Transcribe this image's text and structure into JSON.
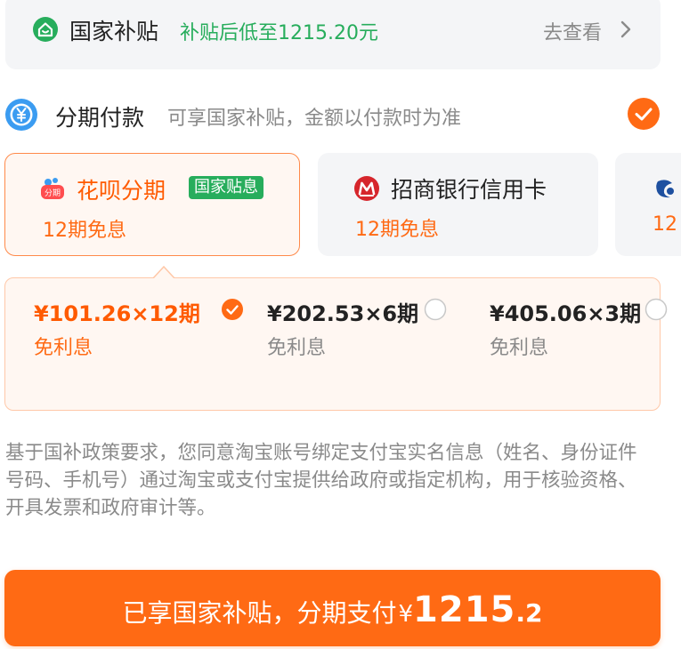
{
  "subsidy_bar": {
    "title": "国家补贴",
    "price_text": "补贴后低至1215.20元",
    "link": "去查看",
    "icon": "house-shield-icon",
    "accent_color": "#27ad5c"
  },
  "installment": {
    "title": "分期付款",
    "subtitle": "可享国家补贴，金额以付款时为准",
    "checked": true,
    "accent_color": "#ff6a14"
  },
  "channels": [
    {
      "name": "花呗分期",
      "badge": "国家贴息",
      "sub": "12期免息",
      "icon": "huabei-icon",
      "icon_text": "分期",
      "selected": true
    },
    {
      "name": "招商银行信用卡",
      "sub": "12期免息",
      "icon": "cmb-icon",
      "selected": false
    },
    {
      "name": "",
      "sub": "12",
      "icon": "bank-icon",
      "selected": false
    }
  ],
  "plans": [
    {
      "price": "¥101.26×12期",
      "sub": "免利息",
      "selected": true
    },
    {
      "price": "¥202.53×6期",
      "sub": "免利息",
      "selected": false
    },
    {
      "price": "¥405.06×3期",
      "sub": "免利息",
      "selected": false
    }
  ],
  "notice": "基于国补政策要求，您同意淘宝账号绑定支付宝实名信息（姓名、身份证件号码、手机号）通过淘宝或支付宝提供给政府或指定机构，用于核验资格、开具发票和政府审计等。",
  "pay_button": {
    "label": "已享国家补贴，分期支付",
    "currency": "¥",
    "amount_int": "1215",
    "amount_dec": ".2"
  }
}
